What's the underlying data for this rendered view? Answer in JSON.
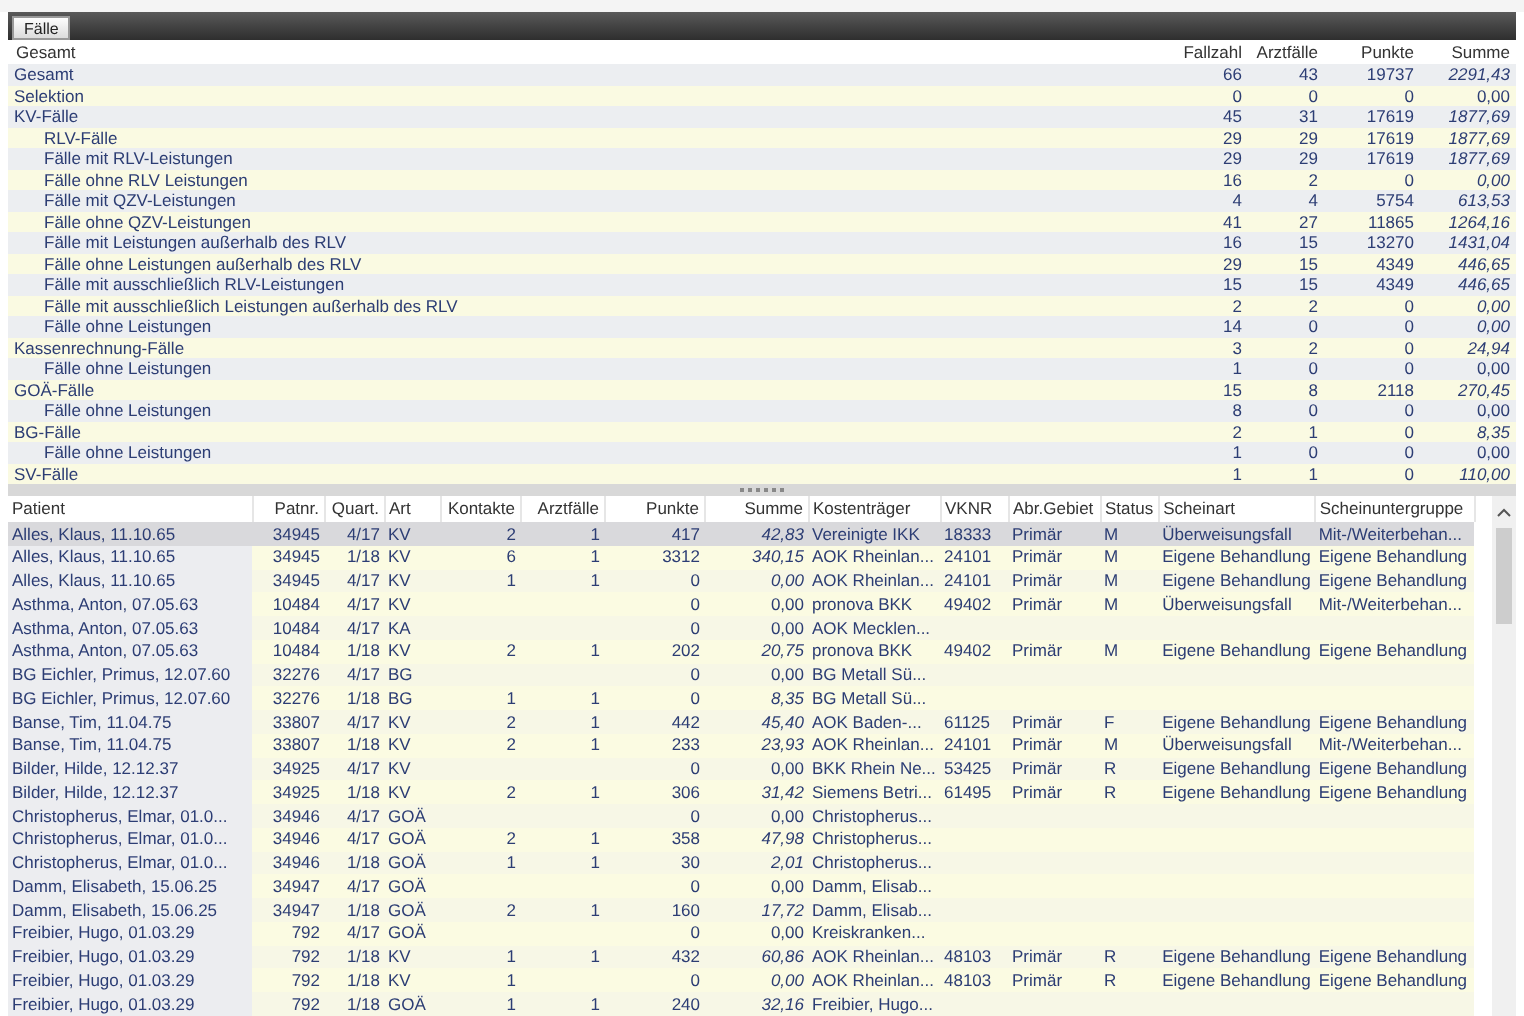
{
  "tabs": [
    {
      "label": "Fälle",
      "selected": true
    }
  ],
  "summary": {
    "columns": [
      "Gesamt",
      "Fallzahl",
      "Arztfälle",
      "Punkte",
      "Summe"
    ],
    "rows": [
      {
        "label": "Gesamt",
        "fallzahl": "66",
        "arztfaelle": "43",
        "punkte": "19737",
        "summe": "2291,43",
        "summe_flagged": true
      },
      {
        "label": "Selektion",
        "fallzahl": "0",
        "arztfaelle": "0",
        "punkte": "0",
        "summe": "0,00",
        "summe_flagged": false
      },
      {
        "label": "KV-Fälle",
        "fallzahl": "45",
        "arztfaelle": "31",
        "punkte": "17619",
        "summe": "1877,69",
        "summe_flagged": true,
        "children": [
          {
            "label": "RLV-Fälle",
            "fallzahl": "29",
            "arztfaelle": "29",
            "punkte": "17619",
            "summe": "1877,69",
            "summe_flagged": true
          },
          {
            "label": "Fälle mit RLV-Leistungen",
            "fallzahl": "29",
            "arztfaelle": "29",
            "punkte": "17619",
            "summe": "1877,69",
            "summe_flagged": true
          },
          {
            "label": "Fälle ohne RLV Leistungen",
            "fallzahl": "16",
            "arztfaelle": "2",
            "punkte": "0",
            "summe": "0,00",
            "summe_flagged": true
          },
          {
            "label": "Fälle mit QZV-Leistungen",
            "fallzahl": "4",
            "arztfaelle": "4",
            "punkte": "5754",
            "summe": "613,53",
            "summe_flagged": true
          },
          {
            "label": "Fälle ohne QZV-Leistungen",
            "fallzahl": "41",
            "arztfaelle": "27",
            "punkte": "11865",
            "summe": "1264,16",
            "summe_flagged": true
          },
          {
            "label": "Fälle mit Leistungen außerhalb des RLV",
            "fallzahl": "16",
            "arztfaelle": "15",
            "punkte": "13270",
            "summe": "1431,04",
            "summe_flagged": true
          },
          {
            "label": "Fälle ohne Leistungen außerhalb des RLV",
            "fallzahl": "29",
            "arztfaelle": "15",
            "punkte": "4349",
            "summe": "446,65",
            "summe_flagged": true
          },
          {
            "label": "Fälle mit ausschließlich RLV-Leistungen",
            "fallzahl": "15",
            "arztfaelle": "15",
            "punkte": "4349",
            "summe": "446,65",
            "summe_flagged": true
          },
          {
            "label": "Fälle mit ausschließlich Leistungen außerhalb des RLV",
            "fallzahl": "2",
            "arztfaelle": "2",
            "punkte": "0",
            "summe": "0,00",
            "summe_flagged": true
          },
          {
            "label": "Fälle ohne Leistungen",
            "fallzahl": "14",
            "arztfaelle": "0",
            "punkte": "0",
            "summe": "0,00",
            "summe_flagged": true
          }
        ]
      },
      {
        "label": "Kassenrechnung-Fälle",
        "fallzahl": "3",
        "arztfaelle": "2",
        "punkte": "0",
        "summe": "24,94",
        "summe_flagged": true,
        "children": [
          {
            "label": "Fälle ohne Leistungen",
            "fallzahl": "1",
            "arztfaelle": "0",
            "punkte": "0",
            "summe": "0,00",
            "summe_flagged": false
          }
        ]
      },
      {
        "label": "GOÄ-Fälle",
        "fallzahl": "15",
        "arztfaelle": "8",
        "punkte": "2118",
        "summe": "270,45",
        "summe_flagged": true,
        "children": [
          {
            "label": "Fälle ohne Leistungen",
            "fallzahl": "8",
            "arztfaelle": "0",
            "punkte": "0",
            "summe": "0,00",
            "summe_flagged": false
          }
        ]
      },
      {
        "label": "BG-Fälle",
        "fallzahl": "2",
        "arztfaelle": "1",
        "punkte": "0",
        "summe": "8,35",
        "summe_flagged": true,
        "children": [
          {
            "label": "Fälle ohne Leistungen",
            "fallzahl": "1",
            "arztfaelle": "0",
            "punkte": "0",
            "summe": "0,00",
            "summe_flagged": false
          }
        ]
      },
      {
        "label": "SV-Fälle",
        "fallzahl": "1",
        "arztfaelle": "1",
        "punkte": "0",
        "summe": "110,00",
        "summe_flagged": true
      }
    ]
  },
  "patients": {
    "columns": [
      "Patient",
      "Patnr.",
      "Quart.",
      "Art",
      "Kontakte",
      "Arztfälle",
      "Punkte",
      "Summe",
      "Kostenträger",
      "VKNR",
      "Abr.Gebiet",
      "Status",
      "Scheinart",
      "Scheinuntergruppe"
    ],
    "rows": [
      {
        "selected": true,
        "summe_flagged": true,
        "cells": [
          "Alles, Klaus, 11.10.65",
          "34945",
          "4/17",
          "KV",
          "2",
          "1",
          "417",
          "42,83",
          "Vereinigte IKK",
          "18333",
          "Primär",
          "M",
          "Überweisungsfall",
          "Mit-/Weiterbehan..."
        ]
      },
      {
        "selected": false,
        "summe_flagged": true,
        "cells": [
          "Alles, Klaus, 11.10.65",
          "34945",
          "1/18",
          "KV",
          "6",
          "1",
          "3312",
          "340,15",
          "AOK Rheinlan...",
          "24101",
          "Primär",
          "M",
          "Eigene Behandlung",
          "Eigene Behandlung"
        ]
      },
      {
        "selected": false,
        "summe_flagged": true,
        "cells": [
          "Alles, Klaus, 11.10.65",
          "34945",
          "4/17",
          "KV",
          "1",
          "1",
          "0",
          "0,00",
          "AOK Rheinlan...",
          "24101",
          "Primär",
          "M",
          "Eigene Behandlung",
          "Eigene Behandlung"
        ]
      },
      {
        "selected": false,
        "summe_flagged": false,
        "cells": [
          "Asthma, Anton, 07.05.63",
          "10484",
          "4/17",
          "KV",
          null,
          null,
          "0",
          "0,00",
          "pronova BKK",
          "49402",
          "Primär",
          "M",
          "Überweisungsfall",
          "Mit-/Weiterbehan..."
        ]
      },
      {
        "selected": false,
        "summe_flagged": false,
        "cells": [
          "Asthma, Anton, 07.05.63",
          "10484",
          "4/17",
          "KA",
          null,
          null,
          "0",
          "0,00",
          "AOK Mecklen..."
        ]
      },
      {
        "selected": false,
        "summe_flagged": true,
        "cells": [
          "Asthma, Anton, 07.05.63",
          "10484",
          "1/18",
          "KV",
          "2",
          "1",
          "202",
          "20,75",
          "pronova BKK",
          "49402",
          "Primär",
          "M",
          "Eigene Behandlung",
          "Eigene Behandlung"
        ]
      },
      {
        "selected": false,
        "summe_flagged": false,
        "cells": [
          "BG Eichler, Primus, 12.07.60",
          "32276",
          "4/17",
          "BG",
          null,
          null,
          "0",
          "0,00",
          "BG Metall Sü..."
        ]
      },
      {
        "selected": false,
        "summe_flagged": true,
        "cells": [
          "BG Eichler, Primus, 12.07.60",
          "32276",
          "1/18",
          "BG",
          "1",
          "1",
          "0",
          "8,35",
          "BG Metall Sü..."
        ]
      },
      {
        "selected": false,
        "summe_flagged": true,
        "cells": [
          "Banse, Tim, 11.04.75",
          "33807",
          "4/17",
          "KV",
          "2",
          "1",
          "442",
          "45,40",
          "AOK Baden-...",
          "61125",
          "Primär",
          "F",
          "Eigene Behandlung",
          "Eigene Behandlung"
        ]
      },
      {
        "selected": false,
        "summe_flagged": true,
        "cells": [
          "Banse, Tim, 11.04.75",
          "33807",
          "1/18",
          "KV",
          "2",
          "1",
          "233",
          "23,93",
          "AOK Rheinlan...",
          "24101",
          "Primär",
          "M",
          "Überweisungsfall",
          "Mit-/Weiterbehan..."
        ]
      },
      {
        "selected": false,
        "summe_flagged": false,
        "cells": [
          "Bilder, Hilde, 12.12.37",
          "34925",
          "4/17",
          "KV",
          null,
          null,
          "0",
          "0,00",
          "BKK Rhein Ne...",
          "53425",
          "Primär",
          "R",
          "Eigene Behandlung",
          "Eigene Behandlung"
        ]
      },
      {
        "selected": false,
        "summe_flagged": true,
        "cells": [
          "Bilder, Hilde, 12.12.37",
          "34925",
          "1/18",
          "KV",
          "2",
          "1",
          "306",
          "31,42",
          "Siemens Betri...",
          "61495",
          "Primär",
          "R",
          "Eigene Behandlung",
          "Eigene Behandlung"
        ]
      },
      {
        "selected": false,
        "summe_flagged": false,
        "cells": [
          "Christopherus, Elmar, 01.0...",
          "34946",
          "4/17",
          "GOÄ",
          null,
          null,
          "0",
          "0,00",
          "Christopherus..."
        ]
      },
      {
        "selected": false,
        "summe_flagged": true,
        "cells": [
          "Christopherus, Elmar, 01.0...",
          "34946",
          "4/17",
          "GOÄ",
          "2",
          "1",
          "358",
          "47,98",
          "Christopherus..."
        ]
      },
      {
        "selected": false,
        "summe_flagged": true,
        "cells": [
          "Christopherus, Elmar, 01.0...",
          "34946",
          "1/18",
          "GOÄ",
          "1",
          "1",
          "30",
          "2,01",
          "Christopherus..."
        ]
      },
      {
        "selected": false,
        "summe_flagged": false,
        "cells": [
          "Damm, Elisabeth, 15.06.25",
          "34947",
          "4/17",
          "GOÄ",
          null,
          null,
          "0",
          "0,00",
          "Damm, Elisab..."
        ]
      },
      {
        "selected": false,
        "summe_flagged": true,
        "cells": [
          "Damm, Elisabeth, 15.06.25",
          "34947",
          "1/18",
          "GOÄ",
          "2",
          "1",
          "160",
          "17,72",
          "Damm, Elisab..."
        ]
      },
      {
        "selected": false,
        "summe_flagged": false,
        "cells": [
          "Freibier, Hugo, 01.03.29",
          "792",
          "4/17",
          "GOÄ",
          null,
          null,
          "0",
          "0,00",
          "Kreiskranken..."
        ]
      },
      {
        "selected": false,
        "summe_flagged": true,
        "cells": [
          "Freibier, Hugo, 01.03.29",
          "792",
          "1/18",
          "KV",
          "1",
          "1",
          "432",
          "60,86",
          "AOK Rheinlan...",
          "48103",
          "Primär",
          "R",
          "Eigene Behandlung",
          "Eigene Behandlung"
        ]
      },
      {
        "selected": false,
        "summe_flagged": true,
        "cells": [
          "Freibier, Hugo, 01.03.29",
          "792",
          "1/18",
          "KV",
          "1",
          null,
          "0",
          "0,00",
          "AOK Rheinlan...",
          "48103",
          "Primär",
          "R",
          "Eigene Behandlung",
          "Eigene Behandlung"
        ]
      },
      {
        "selected": false,
        "summe_flagged": true,
        "cells": [
          "Freibier, Hugo, 01.03.29",
          "792",
          "1/18",
          "GOÄ",
          "1",
          "1",
          "240",
          "32,16",
          "Freibier, Hugo..."
        ]
      }
    ]
  }
}
